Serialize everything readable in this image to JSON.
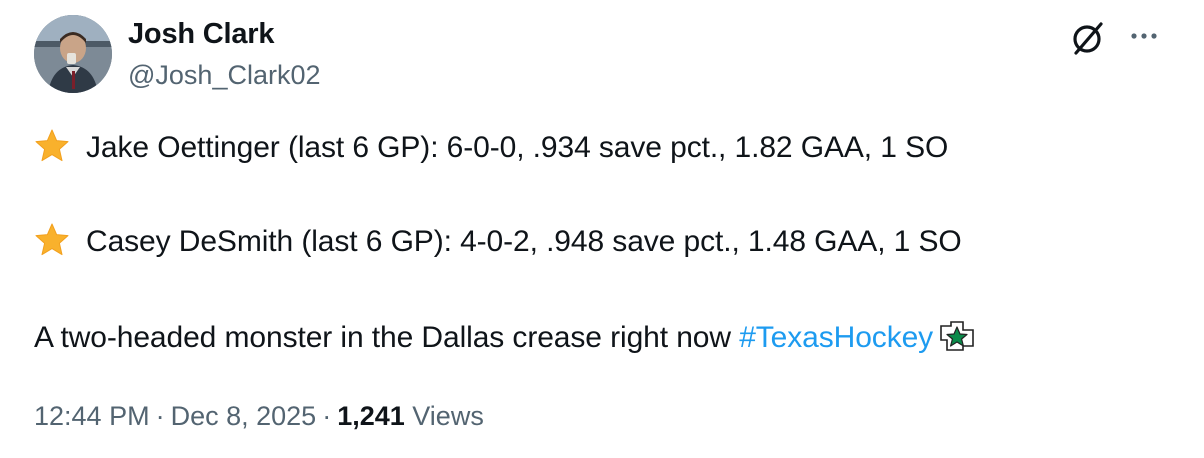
{
  "author": {
    "name": "Josh Clark",
    "handle": "@Josh_Clark02"
  },
  "tweet": {
    "line1": "Jake Oettinger (last 6 GP): 6-0-0, .934 save pct., 1.82 GAA, 1 SO",
    "line2": "Casey DeSmith (last 6 GP): 4-0-2, .948 save pct., 1.48 GAA, 1 SO",
    "line3_text": "A two-headed monster in the Dallas crease right now ",
    "hashtag": "#TexasHockey"
  },
  "meta": {
    "time": "12:44 PM",
    "separator": "·",
    "date": "Dec 8, 2025",
    "views_count": "1,241",
    "views_label": "Views"
  },
  "icons": {
    "grok": "grok-icon",
    "more": "more-icon",
    "bullet": "star-emoji-icon",
    "team": "dallas-stars-logo-icon"
  },
  "colors": {
    "text": "#0f1419",
    "secondary": "#536471",
    "link": "#1d9bf0",
    "star": "#f9b12c",
    "stars_green": "#0a8a4a"
  }
}
